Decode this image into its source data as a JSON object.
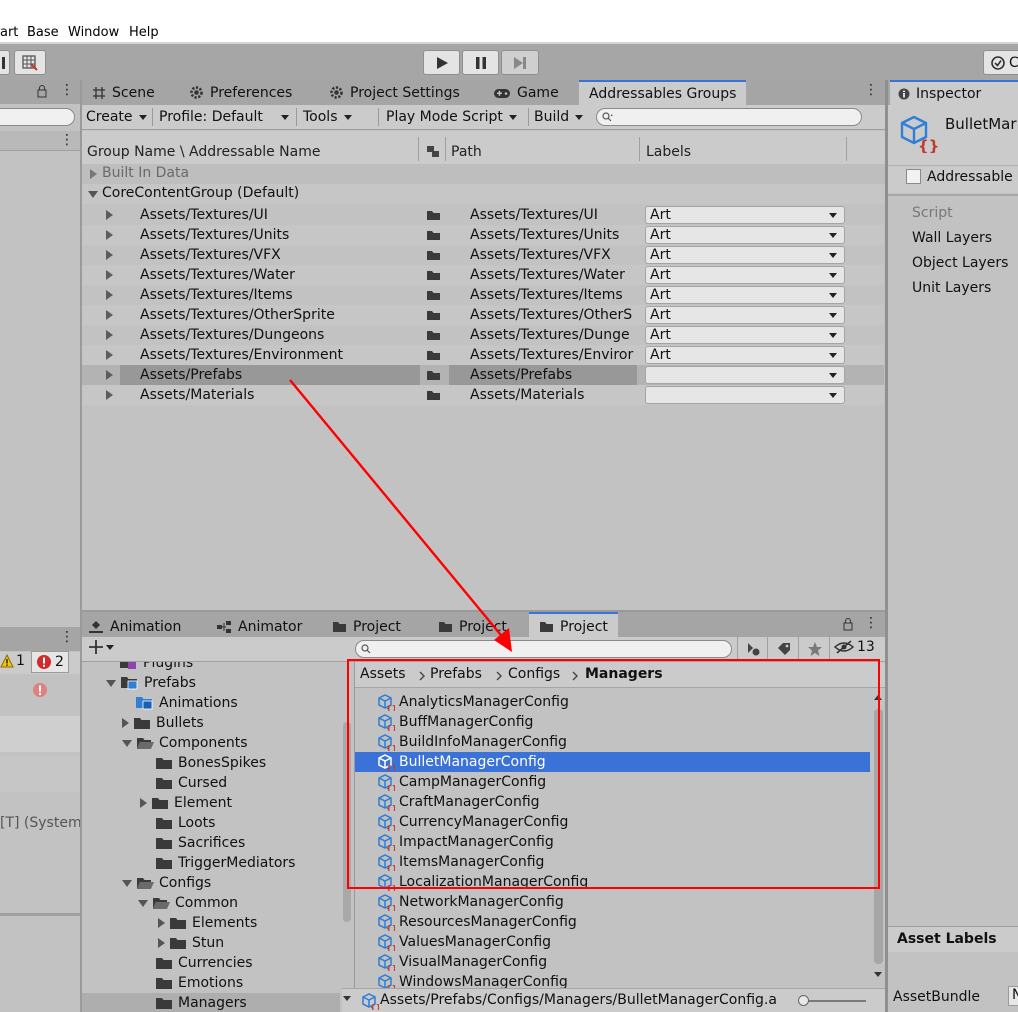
{
  "menu": {
    "items": [
      "art",
      "Base",
      "Window",
      "Help"
    ]
  },
  "toolbar": {
    "right_button": "C"
  },
  "main_tabs": [
    {
      "label": "Scene",
      "icon": "grid-icon"
    },
    {
      "label": "Preferences",
      "icon": "gear-icon"
    },
    {
      "label": "Project Settings",
      "icon": "gear-icon"
    },
    {
      "label": "Game",
      "icon": "gamepad-icon"
    },
    {
      "label": "Addressables Groups",
      "icon": ""
    }
  ],
  "addressables": {
    "create": "Create",
    "profile": "Profile: Default",
    "tools": "Tools",
    "play_mode": "Play Mode Script",
    "build": "Build",
    "columns": {
      "name": "Group Name \\ Addressable Name",
      "path": "Path",
      "labels": "Labels"
    },
    "groups": [
      {
        "label": "Built In Data"
      },
      {
        "label": "CoreContentGroup (Default)"
      }
    ],
    "entries": [
      {
        "name": "Assets/Textures/UI",
        "path": "Assets/Textures/UI",
        "label": "Art"
      },
      {
        "name": "Assets/Textures/Units",
        "path": "Assets/Textures/Units",
        "label": "Art"
      },
      {
        "name": "Assets/Textures/VFX",
        "path": "Assets/Textures/VFX",
        "label": "Art"
      },
      {
        "name": "Assets/Textures/Water",
        "path": "Assets/Textures/Water",
        "label": "Art"
      },
      {
        "name": "Assets/Textures/Items",
        "path": "Assets/Textures/Items",
        "label": "Art"
      },
      {
        "name": "Assets/Textures/OtherSprite",
        "path": "Assets/Textures/OtherS",
        "label": "Art"
      },
      {
        "name": "Assets/Textures/Dungeons",
        "path": "Assets/Textures/Dunge",
        "label": "Art"
      },
      {
        "name": "Assets/Textures/Environment",
        "path": "Assets/Textures/Enviror",
        "label": "Art"
      },
      {
        "name": "Assets/Prefabs",
        "path": "Assets/Prefabs",
        "label": ""
      },
      {
        "name": "Assets/Materials",
        "path": "Assets/Materials",
        "label": ""
      }
    ]
  },
  "inspector": {
    "tab": "Inspector",
    "object_name": "BulletMar",
    "addressable_label": "Addressable",
    "fields": [
      "Script",
      "Wall Layers",
      "Object Layers",
      "Unit Layers"
    ],
    "asset_labels": "Asset Labels",
    "asset_bundle": "AssetBundle",
    "asset_bundle_value": "N"
  },
  "bottom_tabs": [
    {
      "label": "Animation",
      "icon": "animation-icon"
    },
    {
      "label": "Animator",
      "icon": "animator-icon"
    },
    {
      "label": "Project",
      "icon": "folder-icon"
    },
    {
      "label": "Project",
      "icon": "folder-icon"
    },
    {
      "label": "Project",
      "icon": "folder-icon"
    }
  ],
  "console": {
    "warnings": "1",
    "errors": "2",
    "log_text": "[T] (System"
  },
  "project": {
    "hidden_count": "13",
    "breadcrumb": [
      "Assets",
      "Prefabs",
      "Configs",
      "Managers"
    ],
    "tree": [
      {
        "label": "Plugins"
      },
      {
        "label": "Prefabs"
      },
      {
        "label": "Animations"
      },
      {
        "label": "Bullets"
      },
      {
        "label": "Components"
      },
      {
        "label": "BonesSpikes"
      },
      {
        "label": "Cursed"
      },
      {
        "label": "Element"
      },
      {
        "label": "Loots"
      },
      {
        "label": "Sacrifices"
      },
      {
        "label": "TriggerMediators"
      },
      {
        "label": "Configs"
      },
      {
        "label": "Common"
      },
      {
        "label": "Elements"
      },
      {
        "label": "Stun"
      },
      {
        "label": "Currencies"
      },
      {
        "label": "Emotions"
      },
      {
        "label": "Managers"
      }
    ],
    "files": [
      {
        "label": "AnalyticsManagerConfig"
      },
      {
        "label": "BuffManagerConfig"
      },
      {
        "label": "BuildInfoManagerConfig"
      },
      {
        "label": "BulletManagerConfig"
      },
      {
        "label": "CampManagerConfig"
      },
      {
        "label": "CraftManagerConfig"
      },
      {
        "label": "CurrencyManagerConfig"
      },
      {
        "label": "ImpactManagerConfig"
      },
      {
        "label": "ItemsManagerConfig"
      },
      {
        "label": "LocalizationManagerConfig"
      },
      {
        "label": "NetworkManagerConfig"
      },
      {
        "label": "ResourcesManagerConfig"
      },
      {
        "label": "ValuesManagerConfig"
      },
      {
        "label": "VisualManagerConfig"
      },
      {
        "label": "WindowsManagerConfig"
      }
    ],
    "status_path": "Assets/Prefabs/Configs/Managers/BulletManagerConfig.a"
  },
  "colors": {
    "selection": "#3a72d8",
    "annotation": "#ff0000",
    "panel": "#c2c2c2"
  }
}
